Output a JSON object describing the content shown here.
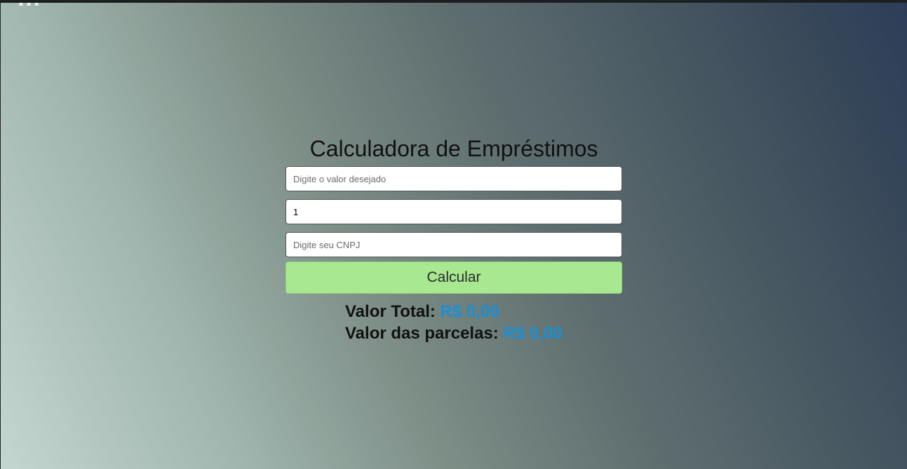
{
  "page": {
    "title": "Calculadora de Empréstimos"
  },
  "form": {
    "value_placeholder": "Digite o valor desejado",
    "value_value": "",
    "installments_value": "1",
    "cnpj_placeholder": "Digite seu CNPJ",
    "cnpj_value": "",
    "submit_label": "Calcular"
  },
  "results": {
    "total_label": "Valor Total:",
    "total_value": "R$ 0,00",
    "installment_label": "Valor das parcelas:",
    "installment_value": "R$ 0,00"
  },
  "colors": {
    "button": "#a8e890",
    "amount": "#1a8fd6"
  }
}
